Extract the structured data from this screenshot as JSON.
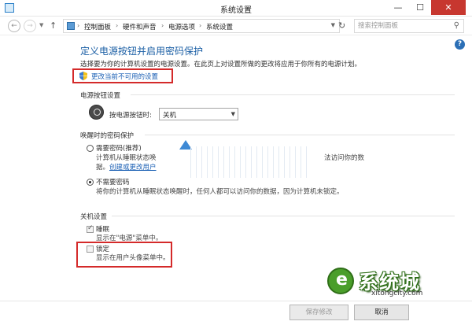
{
  "window": {
    "title": "系统设置",
    "minimize": "—",
    "maximize": "☐",
    "close": "✕"
  },
  "address": {
    "crumbs": [
      "控制面板",
      "硬件和声音",
      "电源选项",
      "系统设置"
    ],
    "search_placeholder": "搜索控制面板"
  },
  "page": {
    "title": "定义电源按钮并启用密码保护",
    "description": "选择要为你的计算机设置的电源设置。在此页上对设置所做的更改将应用于你所有的电源计划。",
    "change_link": "更改当前不可用的设置"
  },
  "power_section": {
    "heading": "电源按钮设置",
    "label": "按电源按钮时:",
    "selected": "关机"
  },
  "wake_section": {
    "heading": "唤醒时的密码保护",
    "require": {
      "label": "需要密码(推荐)",
      "desc_left": "计算机从睡眠状态唤",
      "desc_right": "法访问你的数",
      "desc2_prefix": "据。",
      "desc2_link": "创建或更改用户",
      "checked": false
    },
    "norequire": {
      "label": "不需要密码",
      "desc": "将你的计算机从睡眠状态唤醒时，任何人都可以访问你的数据，因为计算机未锁定。",
      "checked": true
    }
  },
  "shutdown_section": {
    "heading": "关机设置",
    "sleep": {
      "label": "睡眠",
      "desc": "显示在\"电源\"菜单中。",
      "checked": true
    },
    "lock": {
      "label": "锁定",
      "desc": "显示在用户头像菜单中。",
      "checked": false
    }
  },
  "buttons": {
    "save": "保存修改",
    "cancel": "取消"
  },
  "logo": {
    "text": "系统城",
    "sub": "xitongcity.com"
  }
}
